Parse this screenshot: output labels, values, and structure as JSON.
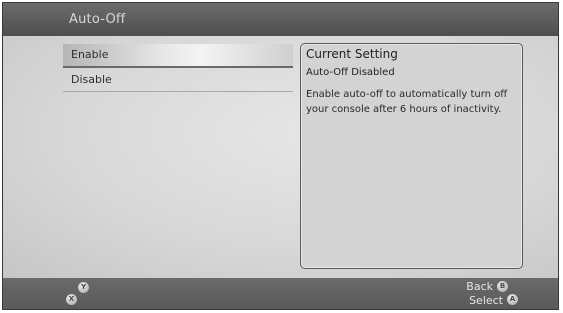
{
  "window": {
    "title": "Auto-Off"
  },
  "menu": {
    "items": [
      {
        "label": "Enable"
      },
      {
        "label": "Disable"
      }
    ]
  },
  "info": {
    "heading": "Current Setting",
    "status": "Auto-Off Disabled",
    "description": "Enable auto-off to automatically turn off your console after 6 hours of inactivity."
  },
  "footer": {
    "y_glyph": "Y",
    "x_glyph": "X",
    "b_glyph": "B",
    "a_glyph": "A",
    "back_label": "Back",
    "select_label": "Select"
  }
}
